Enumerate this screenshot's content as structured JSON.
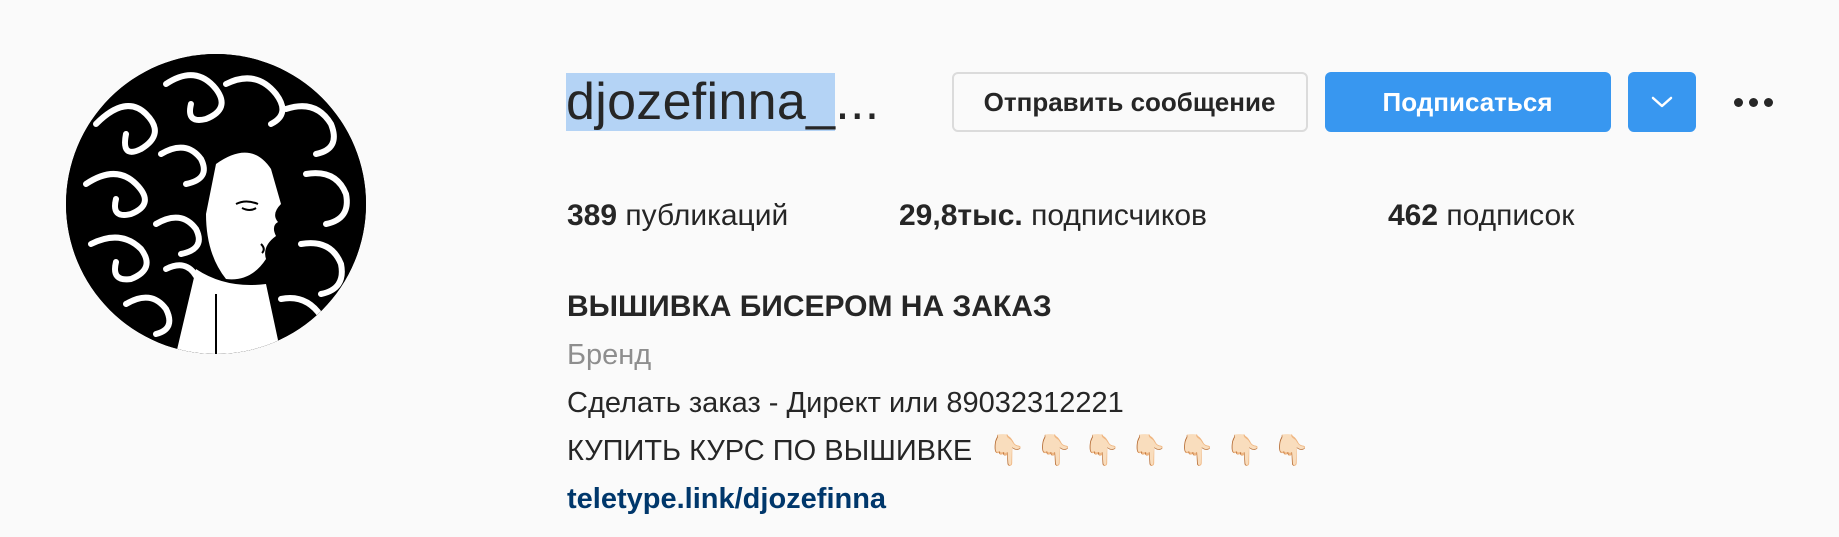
{
  "profile": {
    "username": "djozefinna_",
    "username_ellipsis": "...",
    "buttons": {
      "message": "Отправить сообщение",
      "follow": "Подписаться"
    },
    "stats": {
      "posts_count": "389",
      "posts_label": "публикаций",
      "followers_count": "29,8тыс.",
      "followers_label": "подписчиков",
      "following_count": "462",
      "following_label": "подписок"
    },
    "bio": {
      "name": "ВЫШИВКА БИСЕРОМ НА ЗАКАЗ",
      "category": "Бренд",
      "line1": "Сделать заказ - Директ или 89032312221",
      "line2": "КУПИТЬ КУРС ПО ВЫШИВКЕ",
      "line2_emoji": "👇🏻",
      "link": "teletype.link/djozefinna"
    }
  },
  "colors": {
    "background": "#fafafa",
    "primary_blue": "#3897f0",
    "text": "#262626",
    "secondary_text": "#8e8e8e",
    "link": "#00376b",
    "selection": "#b4d3f5"
  },
  "icons": {
    "dropdown": "chevron-down-icon",
    "more": "more-options-icon",
    "hand": "backhand-index-pointing-down-icon"
  }
}
